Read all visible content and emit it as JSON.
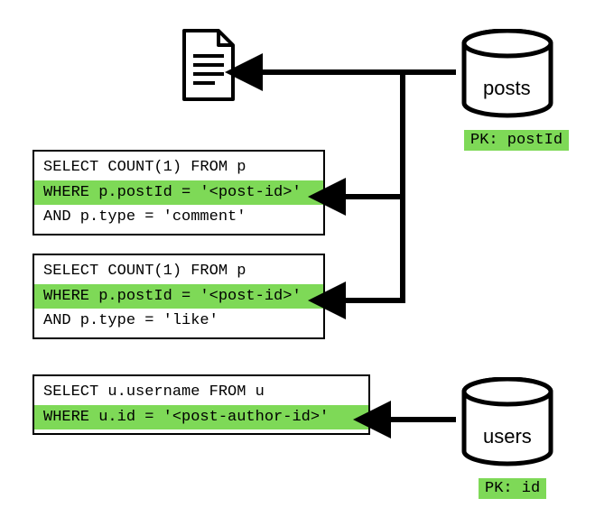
{
  "doc": {
    "name": "document-icon"
  },
  "db_posts": {
    "label": "posts",
    "pk": "PK: postId"
  },
  "db_users": {
    "label": "users",
    "pk": "PK: id"
  },
  "query1": {
    "line1": "SELECT COUNT(1) FROM p",
    "line2": "WHERE p.postId = '<post-id>'",
    "line3": "AND p.type = 'comment'"
  },
  "query2": {
    "line1": "SELECT COUNT(1) FROM p",
    "line2": "WHERE p.postId = '<post-id>'",
    "line3": "AND p.type = 'like'"
  },
  "query3": {
    "line1": "SELECT u.username FROM u",
    "line2": "WHERE u.id = '<post-author-id>'"
  }
}
